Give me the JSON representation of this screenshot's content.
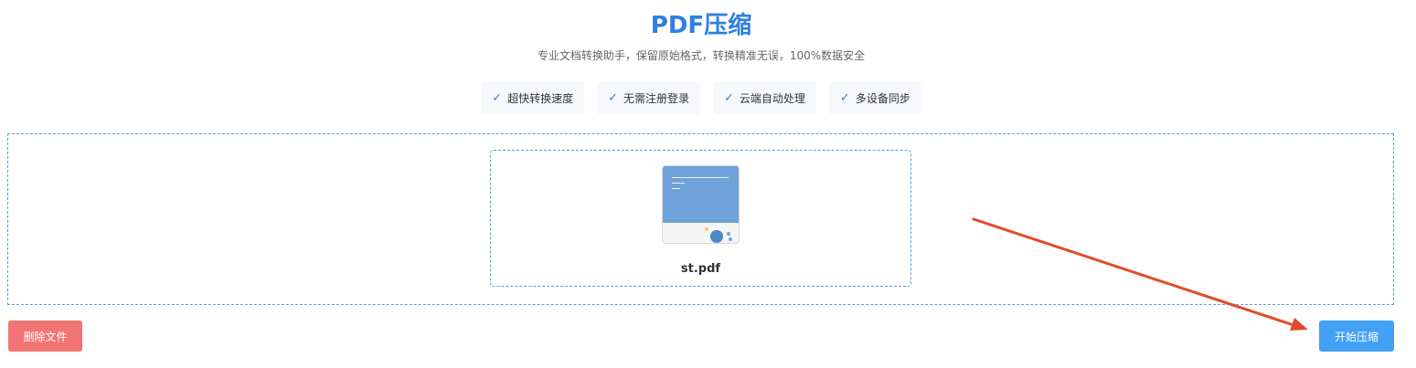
{
  "header": {
    "title": "PDF压缩",
    "subtitle": "专业文档转换助手，保留原始格式，转换精准无误，100%数据安全"
  },
  "features": [
    {
      "icon": "check-icon",
      "label": "超快转换速度"
    },
    {
      "icon": "check-icon",
      "label": "无需注册登录"
    },
    {
      "icon": "check-icon",
      "label": "云端自动处理"
    },
    {
      "icon": "check-icon",
      "label": "多设备同步"
    }
  ],
  "file": {
    "name": "st.pdf",
    "thumbnail_icon": "pdf-thumbnail"
  },
  "actions": {
    "delete_label": "删除文件",
    "start_label": "开始压缩"
  },
  "colors": {
    "title": "#2d7fe0",
    "delete_button": "#f37474",
    "start_button": "#42a0f5",
    "dashed_border": "#5b9bd5",
    "annotation_arrow": "#e34a2a"
  }
}
